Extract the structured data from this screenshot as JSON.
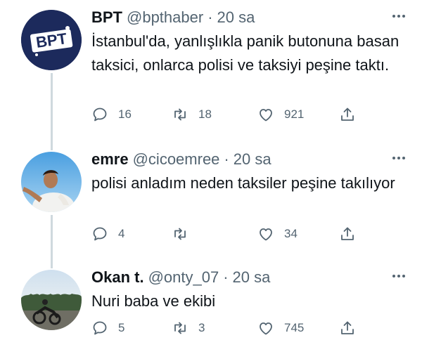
{
  "tweets": [
    {
      "name": "BPT",
      "handle": "@bpthaber",
      "dot": "·",
      "time": "20 sa",
      "text": "İstanbul'da, yanlışlıkla panik butonuna basan taksici, onlarca polisi ve taksiyi peşine taktı.",
      "replies": "16",
      "retweets": "18",
      "likes": "921",
      "avatar_logo": "BPT"
    },
    {
      "name": "emre",
      "handle": "@cicoemree",
      "dot": "·",
      "time": "20 sa",
      "text": "polisi anladım neden taksiler peşine takılıyor",
      "replies": "4",
      "retweets": "",
      "likes": "34"
    },
    {
      "name": "Okan t.",
      "handle": "@onty_07",
      "dot": "·",
      "time": "20 sa",
      "text": "Nuri baba ve ekibi",
      "replies": "5",
      "retweets": "3",
      "likes": "745"
    }
  ],
  "icons": {
    "reply": "reply-icon",
    "retweet": "retweet-icon",
    "like": "heart-icon",
    "share": "share-icon",
    "more": "more-icon"
  },
  "colors": {
    "text": "#0f1419",
    "secondary": "#536471",
    "thread_line": "#cfd9de",
    "bpt_navy": "#1c2a5c"
  }
}
